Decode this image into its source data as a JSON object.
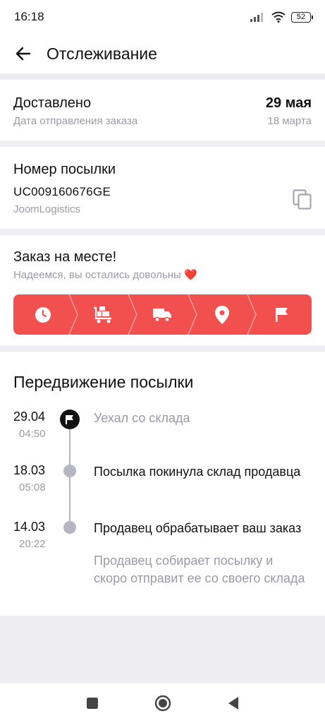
{
  "status_bar": {
    "time": "16:18",
    "battery": "52",
    "icons": [
      "signal-icon",
      "wifi-icon",
      "battery-icon"
    ]
  },
  "app_bar": {
    "title": "Отслеживание",
    "back_icon": "arrow-left-icon"
  },
  "delivery": {
    "status": "Доставлено",
    "sent_label": "Дата отправления заказа",
    "delivery_date": "29 мая",
    "sent_date": "18 марта"
  },
  "parcel": {
    "heading": "Номер посылки",
    "number": "UC009160676GE",
    "carrier": "JoomLogistics",
    "copy_icon": "copy-icon"
  },
  "progress": {
    "heading": "Заказ на месте!",
    "subtitle": "Надеемся, вы остались довольны ❤️",
    "accent_color": "#f24f4f",
    "steps": [
      {
        "icon": "clock-icon"
      },
      {
        "icon": "warehouse-cart-icon"
      },
      {
        "icon": "truck-icon"
      },
      {
        "icon": "location-pin-icon"
      },
      {
        "icon": "flag-icon"
      }
    ]
  },
  "movement": {
    "heading": "Передвижение посылки",
    "events": [
      {
        "date": "29.04",
        "time": "04:50",
        "text": "Уехал со склада",
        "current": true
      },
      {
        "date": "18.03",
        "time": "05:08",
        "text": "Посылка покинула склад продавца",
        "current": false
      },
      {
        "date": "14.03",
        "time": "20:22",
        "text": "Продавец обрабатывает ваш заказ",
        "note": "Продавец собирает посылку и скоро отправит ее со своего склада",
        "current": false
      }
    ]
  },
  "nav_bar": {
    "buttons": [
      "recent-apps-icon",
      "home-icon",
      "back-triangle-icon"
    ]
  }
}
